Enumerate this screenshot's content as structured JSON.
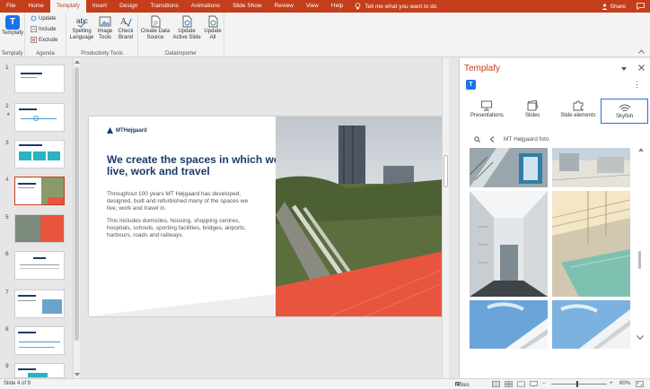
{
  "ribbon_tabs": [
    {
      "label": "File",
      "active": false
    },
    {
      "label": "Home",
      "active": false
    },
    {
      "label": "Templafy",
      "active": true
    },
    {
      "label": "Insert",
      "active": false
    },
    {
      "label": "Design",
      "active": false
    },
    {
      "label": "Transitions",
      "active": false
    },
    {
      "label": "Animations",
      "active": false
    },
    {
      "label": "Slide Show",
      "active": false
    },
    {
      "label": "Review",
      "active": false
    },
    {
      "label": "View",
      "active": false
    },
    {
      "label": "Help",
      "active": false
    }
  ],
  "tell_me": "Tell me what you want to do",
  "share_label": "Share",
  "ribbon": {
    "templafy_group": {
      "button": "Templafy",
      "group_label": "Templafy"
    },
    "agenda_group": {
      "update": "Update",
      "include": "Include",
      "exclude": "Exclude",
      "group_label": "Agenda"
    },
    "productivity_group": {
      "spelling": "Spelling",
      "spelling_sub": "Language",
      "image": "Image",
      "image_sub": "Tools",
      "check": "Check",
      "check_sub": "Brand",
      "group_label": "Productivity Tools"
    },
    "dataimporter_group": {
      "create": "Create Data",
      "create_sub": "Source",
      "update_active": "Update",
      "update_active_sub": "Active Slide",
      "update_all": "Update",
      "update_all_sub": "All",
      "group_label": "DataImporter"
    }
  },
  "thumbnails": [
    {
      "num": "1",
      "star": "",
      "selected": false
    },
    {
      "num": "2",
      "star": "★",
      "selected": false
    },
    {
      "num": "3",
      "star": "",
      "selected": false
    },
    {
      "num": "4",
      "star": "",
      "selected": true
    },
    {
      "num": "5",
      "star": "",
      "selected": false
    },
    {
      "num": "6",
      "star": "",
      "selected": false
    },
    {
      "num": "7",
      "star": "",
      "selected": false
    },
    {
      "num": "8",
      "star": "",
      "selected": false
    },
    {
      "num": "9",
      "star": "",
      "selected": false
    }
  ],
  "slide": {
    "logo": "MTHøjgaard",
    "headline": "We create the spaces in which we live, work and travel",
    "para1": "Throughout 100 years MT Højgaard has developed, designed, built and refurbished many of the spaces we live, work and travel in.",
    "para2": "This includes domiciles, housing, shopping centres, hospitals, schools, sporting facilities, bridges, airports, harbours, roads and railways."
  },
  "panel": {
    "title": "Templafy",
    "menu": "⋮",
    "tabs": [
      {
        "label": "Presentations",
        "icon": "presentation-icon",
        "active": false
      },
      {
        "label": "Slides",
        "icon": "slides-icon",
        "active": false
      },
      {
        "label": "Slide elements",
        "icon": "puzzle-icon",
        "active": false
      },
      {
        "label": "Skyfish",
        "icon": "skyfish-icon",
        "active": true
      }
    ],
    "search_query": "MT Højgaard foto"
  },
  "status": {
    "slide_info": "Slide 4 of 9",
    "notes": "Notes",
    "zoom": "60%"
  },
  "colors": {
    "accent": "#c43e1c",
    "templafy_blue": "#1a73e8",
    "navy": "#1b3a6b",
    "slide_orange": "#e8553e"
  }
}
